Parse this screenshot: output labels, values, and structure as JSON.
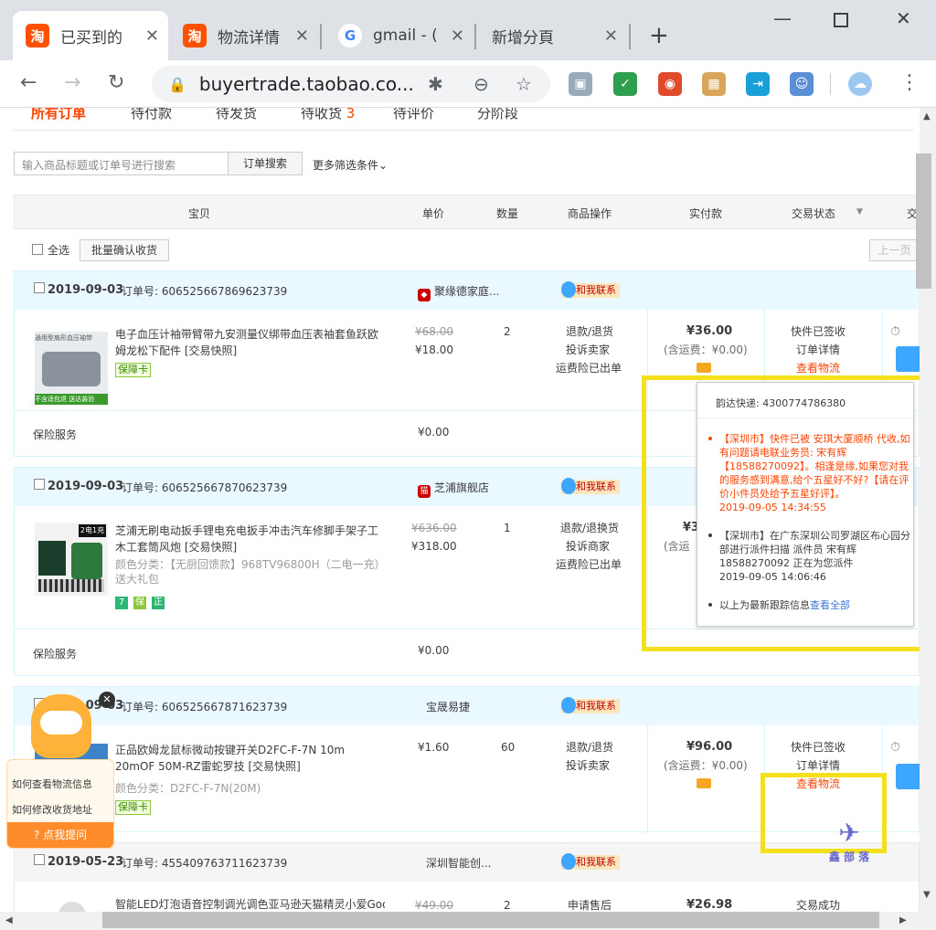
{
  "browser": {
    "tabs": [
      {
        "label": "已买到的",
        "favicon": "taobao-icon"
      },
      {
        "label": "物流详情",
        "favicon": "taobao-icon"
      },
      {
        "label": "gmail - (",
        "favicon": "google-icon"
      },
      {
        "label": "新增分頁",
        "favicon": ""
      }
    ],
    "url": "buyertrade.taobao.co..."
  },
  "nav_tabs": [
    "所有订单",
    "待付款",
    "待发货",
    "待收货",
    "3",
    "待评价",
    "分阶段"
  ],
  "search": {
    "placeholder": "输入商品标题或订单号进行搜索",
    "button": "订单搜索",
    "more": "更多筛选条件"
  },
  "table_header": {
    "item": "宝贝",
    "price": "单价",
    "qty": "数量",
    "ops": "商品操作",
    "paid": "实付款",
    "status": "交易状态",
    "status_arrow": "▼",
    "more": "交"
  },
  "controls": {
    "select_all": "全选",
    "batch_confirm": "批量确认收货",
    "prev_page": "上一页"
  },
  "orders": [
    {
      "date": "2019-09-03",
      "no_label": "订单号:",
      "no": "606525667869623739",
      "shop": "聚缘德家庭...",
      "contact": "和我联系",
      "name": "电子血压计袖带臂带九安测量仪绑带血压表袖套鱼跃欧姆龙松下配件 [交易快照]",
      "badge": "保障卡",
      "orig_price": "¥68.00",
      "price": "¥18.00",
      "qty": "2",
      "ops": [
        "退款/退货",
        "投诉卖家",
        "运费险已出单"
      ],
      "paid": "¥36.00",
      "shipping": "(含运费：¥0.00)",
      "status": [
        "快件已签收",
        "订单详情",
        "查看物流"
      ],
      "service": "保险服务",
      "service_price": "¥0.00",
      "thumb_caption": "通用型扇形血压袖带",
      "thumb_tag": "不含适包退 送达装验"
    },
    {
      "date": "2019-09-03",
      "no_label": "订单号:",
      "no": "606525667870623739",
      "shop": "芝浦旗舰店",
      "contact": "和我联系",
      "name": "芝浦无刷电动扳手锂电充电扳手冲击汽车修脚手架子工木工套筒风炮 [交易快照]",
      "color": "颜色分类：【无厨回馈款】968TV96800H（二电一充）送大礼包",
      "icons": [
        "7",
        "保",
        "正"
      ],
      "orig_price": "¥636.00",
      "price": "¥318.00",
      "qty": "1",
      "ops": [
        "退款/退换货",
        "投诉商家",
        "运费险已出单"
      ],
      "paid": "¥3",
      "shipping": "(含运",
      "service": "保险服务",
      "service_price": "¥0.00",
      "thumb_caption": "2电1充"
    },
    {
      "date": "2019-09-03",
      "no_label": "订单号:",
      "no": "606525667871623739",
      "shop": "宝晟易捷",
      "contact": "和我联系",
      "name": "正品欧姆龙鼠标微动按键开关D2FC-F-7N 10m 20mOF 50M-RZ雷蛇罗技 [交易快照]",
      "color": "颜色分类：D2FC-F-7N(20M)",
      "badge": "保障卡",
      "price": "¥1.60",
      "qty": "60",
      "ops": [
        "退款/退货",
        "投诉卖家"
      ],
      "paid": "¥96.00",
      "shipping": "(含运费：¥0.00)",
      "status": [
        "快件已签收",
        "订单详情",
        "查看物流"
      ]
    },
    {
      "date": "2019-05-23",
      "no_label": "订单号:",
      "no": "455409763711623739",
      "shop": "深圳智能创...",
      "contact": "和我联系",
      "name": "智能LED灯泡语音控制调光调色亚马逊天猫精灵小爱Goo",
      "orig_price": "¥49.00",
      "qty": "2",
      "ops": [
        "申请售后"
      ],
      "paid": "¥26.98",
      "status": [
        "交易成功"
      ]
    }
  ],
  "popup": {
    "title": "韵达快递: 4300774786380",
    "items": [
      {
        "text": "【深圳市】快件已被 安琪大厦顺桥 代收,如有问题请电联业务员: 宋有辉【18588270092】。相逢是缘,如果您对我的服务感到满意,给个五星好不好?【请在评价小件员处给予五星好评】。",
        "time": "2019-09-05 14:34:55"
      },
      {
        "text": "【深圳市】在广东深圳公司罗湖区布心园分部进行派件扫描 派件员 宋有辉 18588270092 正在为您派件",
        "time": "2019-09-05 14:06:46"
      }
    ],
    "footer": "以上为最新跟踪信息",
    "view_all": "查看全部"
  },
  "helper": {
    "q1": "如何查看物流信息",
    "q2": "如何修改收货地址",
    "button": "点我提问"
  },
  "watermark": "鑫 部 落",
  "colors": {
    "accent": "#ff4400",
    "highlight": "#f5e01e",
    "header_bg": "#eaf8ff"
  }
}
